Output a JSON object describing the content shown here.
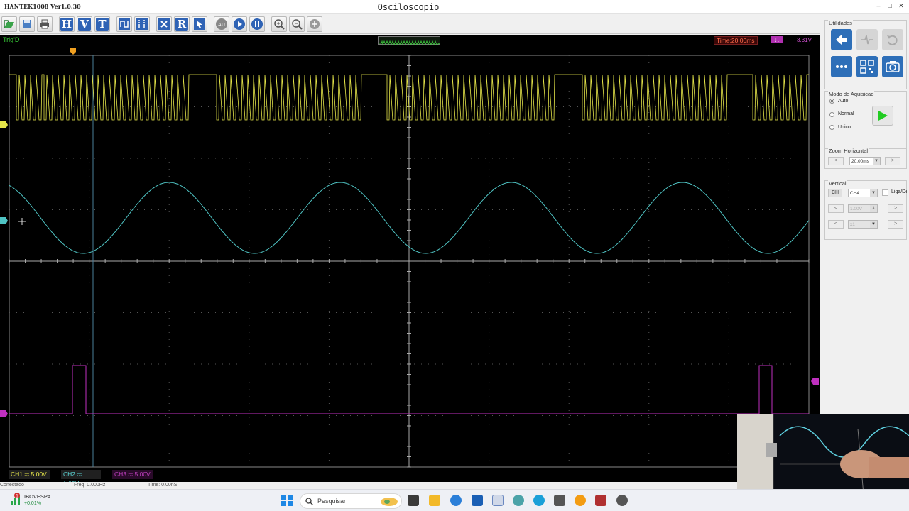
{
  "window": {
    "app_version": "HANTEK1008 Ver1.0.30",
    "title": "Osciloscopio",
    "minimize": "–",
    "maximize": "□",
    "close": "✕"
  },
  "toolbar": {
    "buttons": [
      "open-icon",
      "save-icon",
      "print-icon",
      "H",
      "V",
      "T",
      "measure-icon",
      "cursor-icon",
      "math-icon",
      "R",
      "pointer-icon",
      "auto-icon",
      "run-icon",
      "pause-icon",
      "zoom-in-icon",
      "zoom-out-icon",
      "zoom-reset-icon"
    ]
  },
  "status": {
    "trigger_state": "Trig'D",
    "time_div": "Time:20.00ms",
    "trigger_level": "3.31V"
  },
  "channels": {
    "ch1": "CH1 ⎓   5.00V",
    "ch2": "CH2 ⎓   1.00V",
    "ch3": "CH3 ⎓   5.00V"
  },
  "app_status": {
    "connection": "Conectado",
    "frequency": "Freq: 0.000Hz",
    "time": "Time: 0.00nS"
  },
  "colors": {
    "ch1": "#e6e64a",
    "ch2": "#4fc4c4",
    "ch3": "#c030c0",
    "grid": "#555555"
  },
  "panel": {
    "utilities_title": "Utilidades",
    "acq_title": "Modo de Aquisicao",
    "acq_modes": [
      "Auto",
      "Normal",
      "Unico"
    ],
    "acq_selected": "Auto",
    "zoom_title": "Zoom Horizontal",
    "zoom_value": "20.00ms",
    "vertical_title": "Vertical",
    "ch_button": "CH",
    "ch_select": "CH4",
    "enable_label": "Liga/Desliga",
    "volts_value": "1.00V",
    "probe_value": "x1",
    "prev": "<",
    "next": ">"
  },
  "taskbar": {
    "ticker": "IBOVESPA",
    "change": "+0,01%",
    "search_placeholder": "Pesquisar",
    "notification_count": "1"
  }
}
